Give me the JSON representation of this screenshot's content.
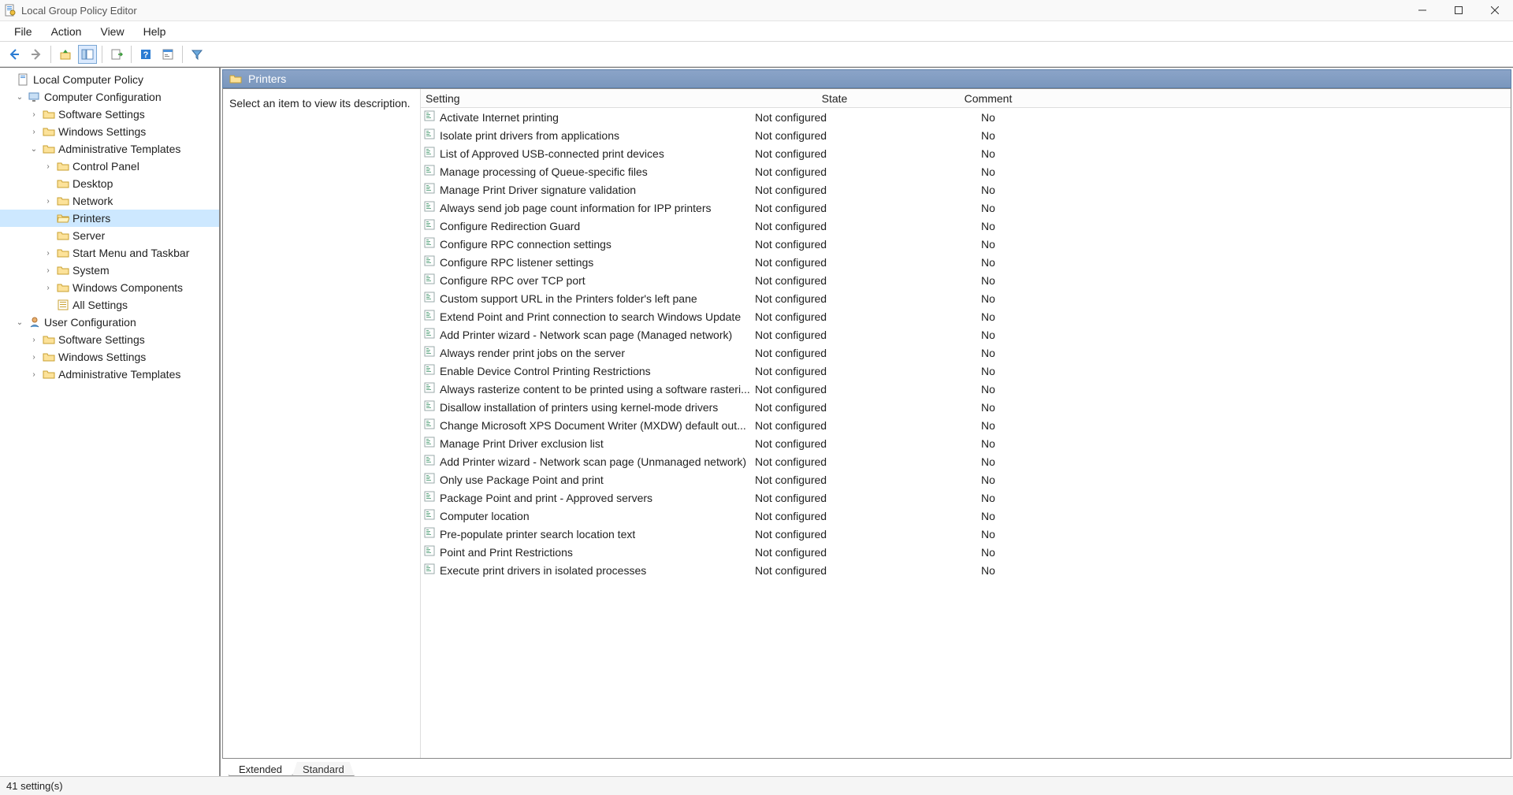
{
  "titlebar": {
    "title": "Local Group Policy Editor"
  },
  "menubar": {
    "items": [
      "File",
      "Action",
      "View",
      "Help"
    ]
  },
  "tree": {
    "root": "Local Computer Policy",
    "cc": "Computer Configuration",
    "cc_children": {
      "sw": "Software Settings",
      "ws": "Windows Settings",
      "at": "Administrative Templates",
      "at_children": {
        "cp": "Control Panel",
        "desktop": "Desktop",
        "network": "Network",
        "printers": "Printers",
        "server": "Server",
        "start": "Start Menu and Taskbar",
        "system": "System",
        "wincomp": "Windows Components",
        "allset": "All Settings"
      }
    },
    "uc": "User Configuration",
    "uc_children": {
      "sw": "Software Settings",
      "ws": "Windows Settings",
      "at": "Administrative Templates"
    }
  },
  "content": {
    "header_title": "Printers",
    "description_prompt": "Select an item to view its description.",
    "columns": {
      "setting": "Setting",
      "state": "State",
      "comment": "Comment"
    },
    "tabs": {
      "extended": "Extended",
      "standard": "Standard"
    }
  },
  "settings": [
    {
      "name": "Activate Internet printing",
      "state": "Not configured",
      "comment": "No"
    },
    {
      "name": "Isolate print drivers from applications",
      "state": "Not configured",
      "comment": "No"
    },
    {
      "name": "List of Approved USB-connected print devices",
      "state": "Not configured",
      "comment": "No"
    },
    {
      "name": "Manage processing of Queue-specific files",
      "state": "Not configured",
      "comment": "No"
    },
    {
      "name": "Manage Print Driver signature validation",
      "state": "Not configured",
      "comment": "No"
    },
    {
      "name": "Always send job page count information for IPP printers",
      "state": "Not configured",
      "comment": "No"
    },
    {
      "name": "Configure Redirection Guard",
      "state": "Not configured",
      "comment": "No"
    },
    {
      "name": "Configure RPC connection settings",
      "state": "Not configured",
      "comment": "No"
    },
    {
      "name": "Configure RPC listener settings",
      "state": "Not configured",
      "comment": "No"
    },
    {
      "name": "Configure RPC over TCP port",
      "state": "Not configured",
      "comment": "No"
    },
    {
      "name": "Custom support URL in the Printers folder's left pane",
      "state": "Not configured",
      "comment": "No"
    },
    {
      "name": "Extend Point and Print connection to search Windows Update",
      "state": "Not configured",
      "comment": "No"
    },
    {
      "name": "Add Printer wizard - Network scan page (Managed network)",
      "state": "Not configured",
      "comment": "No"
    },
    {
      "name": "Always render print jobs on the server",
      "state": "Not configured",
      "comment": "No"
    },
    {
      "name": "Enable Device Control Printing Restrictions",
      "state": "Not configured",
      "comment": "No"
    },
    {
      "name": "Always rasterize content to be printed using a software rasteri...",
      "state": "Not configured",
      "comment": "No"
    },
    {
      "name": "Disallow installation of printers using kernel-mode drivers",
      "state": "Not configured",
      "comment": "No"
    },
    {
      "name": "Change Microsoft XPS Document Writer (MXDW) default out...",
      "state": "Not configured",
      "comment": "No"
    },
    {
      "name": "Manage Print Driver exclusion list",
      "state": "Not configured",
      "comment": "No"
    },
    {
      "name": "Add Printer wizard - Network scan page (Unmanaged network)",
      "state": "Not configured",
      "comment": "No"
    },
    {
      "name": "Only use Package Point and print",
      "state": "Not configured",
      "comment": "No"
    },
    {
      "name": "Package Point and print - Approved servers",
      "state": "Not configured",
      "comment": "No"
    },
    {
      "name": "Computer location",
      "state": "Not configured",
      "comment": "No"
    },
    {
      "name": "Pre-populate printer search location text",
      "state": "Not configured",
      "comment": "No"
    },
    {
      "name": "Point and Print Restrictions",
      "state": "Not configured",
      "comment": "No"
    },
    {
      "name": "Execute print drivers in isolated processes",
      "state": "Not configured",
      "comment": "No"
    }
  ],
  "statusbar": {
    "text": "41 setting(s)"
  }
}
